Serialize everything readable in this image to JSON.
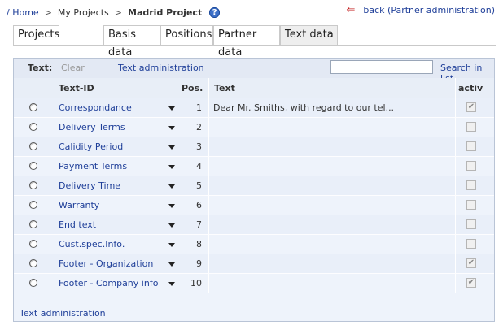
{
  "breadcrumb": {
    "home": "/ Home",
    "sep": ">",
    "projects": "My Projects",
    "current": "Madrid Project"
  },
  "help_icon": "?",
  "back": {
    "arrow": "⇐",
    "label": "back  (Partner administration)"
  },
  "tabs": [
    {
      "label": "Projects"
    },
    {
      "label": "Basis data"
    },
    {
      "label": "Positions"
    },
    {
      "label": "Partner data"
    },
    {
      "label": "Text data",
      "active": true
    }
  ],
  "toolbar": {
    "label": "Text:",
    "clear": "Clear",
    "admin": "Text administration",
    "search_value": "",
    "search_button": "Search in list"
  },
  "columns": {
    "text_id": "Text-ID",
    "pos": "Pos.",
    "text": "Text",
    "activ": "activ"
  },
  "rows": [
    {
      "text_id": "Correspondance",
      "pos": "1",
      "text": "Dear Mr. Smiths, with regard to our tel...",
      "activ": true
    },
    {
      "text_id": "Delivery Terms",
      "pos": "2",
      "text": "",
      "activ": false
    },
    {
      "text_id": "Calidity Period",
      "pos": "3",
      "text": "",
      "activ": false
    },
    {
      "text_id": "Payment Terms",
      "pos": "4",
      "text": "",
      "activ": false
    },
    {
      "text_id": "Delivery Time",
      "pos": "5",
      "text": "",
      "activ": false
    },
    {
      "text_id": "Warranty",
      "pos": "6",
      "text": "",
      "activ": false
    },
    {
      "text_id": "End text",
      "pos": "7",
      "text": "",
      "activ": false
    },
    {
      "text_id": "Cust.spec.Info.",
      "pos": "8",
      "text": "",
      "activ": false
    },
    {
      "text_id": "Footer - Organization",
      "pos": "9",
      "text": "",
      "activ": true
    },
    {
      "text_id": "Footer - Company info",
      "pos": "10",
      "text": "",
      "activ": true
    }
  ],
  "footer_link": "Text administration"
}
